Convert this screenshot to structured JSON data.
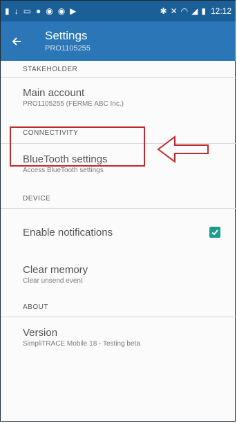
{
  "status_bar": {
    "time": "12:12"
  },
  "app_bar": {
    "title": "Settings",
    "subtitle": "PRO1105255"
  },
  "sections": {
    "stakeholder": "STAKEHOLDER",
    "connectivity": "CONNECTIVITY",
    "device": "DEVICE",
    "about": "ABOUT"
  },
  "items": {
    "main_account": {
      "title": "Main account",
      "summary": "PRO1105255 (FERME ABC Inc.)"
    },
    "bluetooth": {
      "title": "BlueTooth settings",
      "summary": "Access BlueTooth settings"
    },
    "notifications": {
      "title": "Enable notifications",
      "checked": true
    },
    "clear_memory": {
      "title": "Clear memory",
      "summary": "Clear unsend event"
    },
    "version": {
      "title": "Version",
      "summary": "SimpliTRACE Mobile 18 - Testing beta"
    }
  },
  "colors": {
    "status_bar": "#1b5f98",
    "app_bar": "#2a76b6",
    "accent": "#1e9b8f",
    "highlight": "#c0282b"
  }
}
